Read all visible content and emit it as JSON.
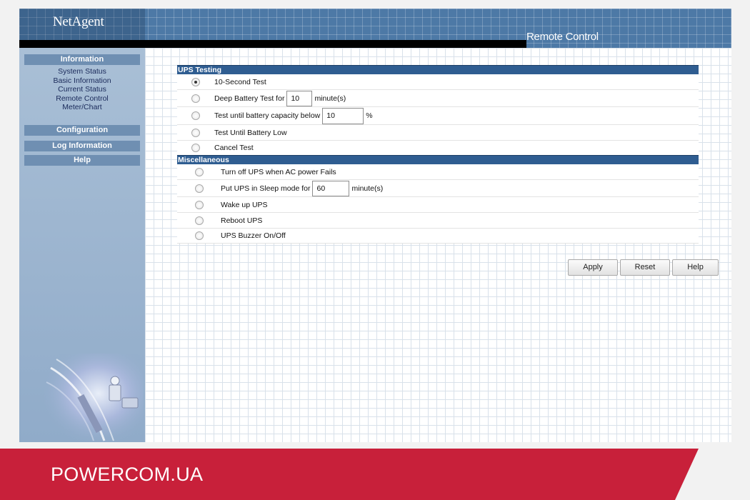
{
  "header": {
    "logo": "NetAgent",
    "title": "Remote Control"
  },
  "sidebar": {
    "information": "Information",
    "links": [
      "System Status",
      "Basic Information",
      "Current Status",
      "Remote Control",
      "Meter/Chart"
    ],
    "configuration": "Configuration",
    "log_information": "Log Information",
    "help": "Help"
  },
  "ups_testing": {
    "title": "UPS Testing",
    "ten_second": "10-Second Test",
    "deep_battery_prefix": "Deep Battery Test for",
    "deep_battery_value": "10",
    "deep_battery_unit": "minute(s)",
    "capacity_prefix": "Test until battery capacity below",
    "capacity_value": "10",
    "capacity_unit": "%",
    "until_low": "Test Until Battery Low",
    "cancel": "Cancel Test"
  },
  "misc": {
    "title": "Miscellaneous",
    "turn_off": "Turn off UPS when AC power Fails",
    "sleep_prefix": "Put UPS in Sleep mode for",
    "sleep_value": "60",
    "sleep_unit": "minute(s)",
    "wake": "Wake up UPS",
    "reboot": "Reboot UPS",
    "buzzer": "UPS Buzzer On/Off"
  },
  "buttons": {
    "apply": "Apply",
    "reset": "Reset",
    "help": "Help"
  },
  "footer": {
    "brand": "POWERCOM.UA",
    "color": "#c8203a"
  }
}
